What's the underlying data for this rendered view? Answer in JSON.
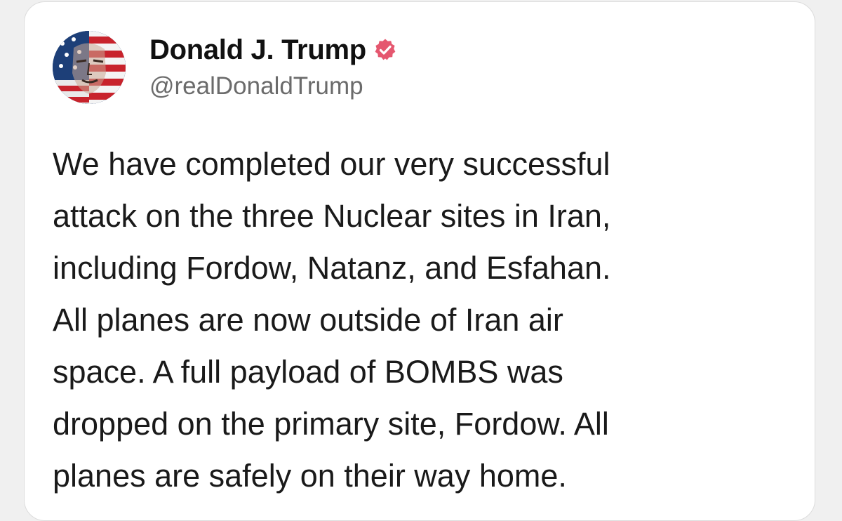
{
  "post": {
    "author": {
      "display_name": "Donald J. Trump",
      "handle": "@realDonaldTrump",
      "verified": true,
      "verified_icon": "verified-badge-icon",
      "avatar_icon": "profile-avatar"
    },
    "body_lines": [
      "We have completed our very successful",
      "attack on the three Nuclear sites in Iran,",
      "including Fordow, Natanz, and Esfahan.",
      "All planes are now outside of Iran air",
      "space. A full payload of BOMBS was",
      "dropped on the primary site, Fordow. All",
      "planes are safely on their way home."
    ]
  },
  "colors": {
    "card_background": "#ffffff",
    "page_background": "#f0f0f0",
    "badge": "#e5576f",
    "name_text": "#111111",
    "handle_text": "#6b6b6b",
    "body_text": "#1a1a1a"
  }
}
